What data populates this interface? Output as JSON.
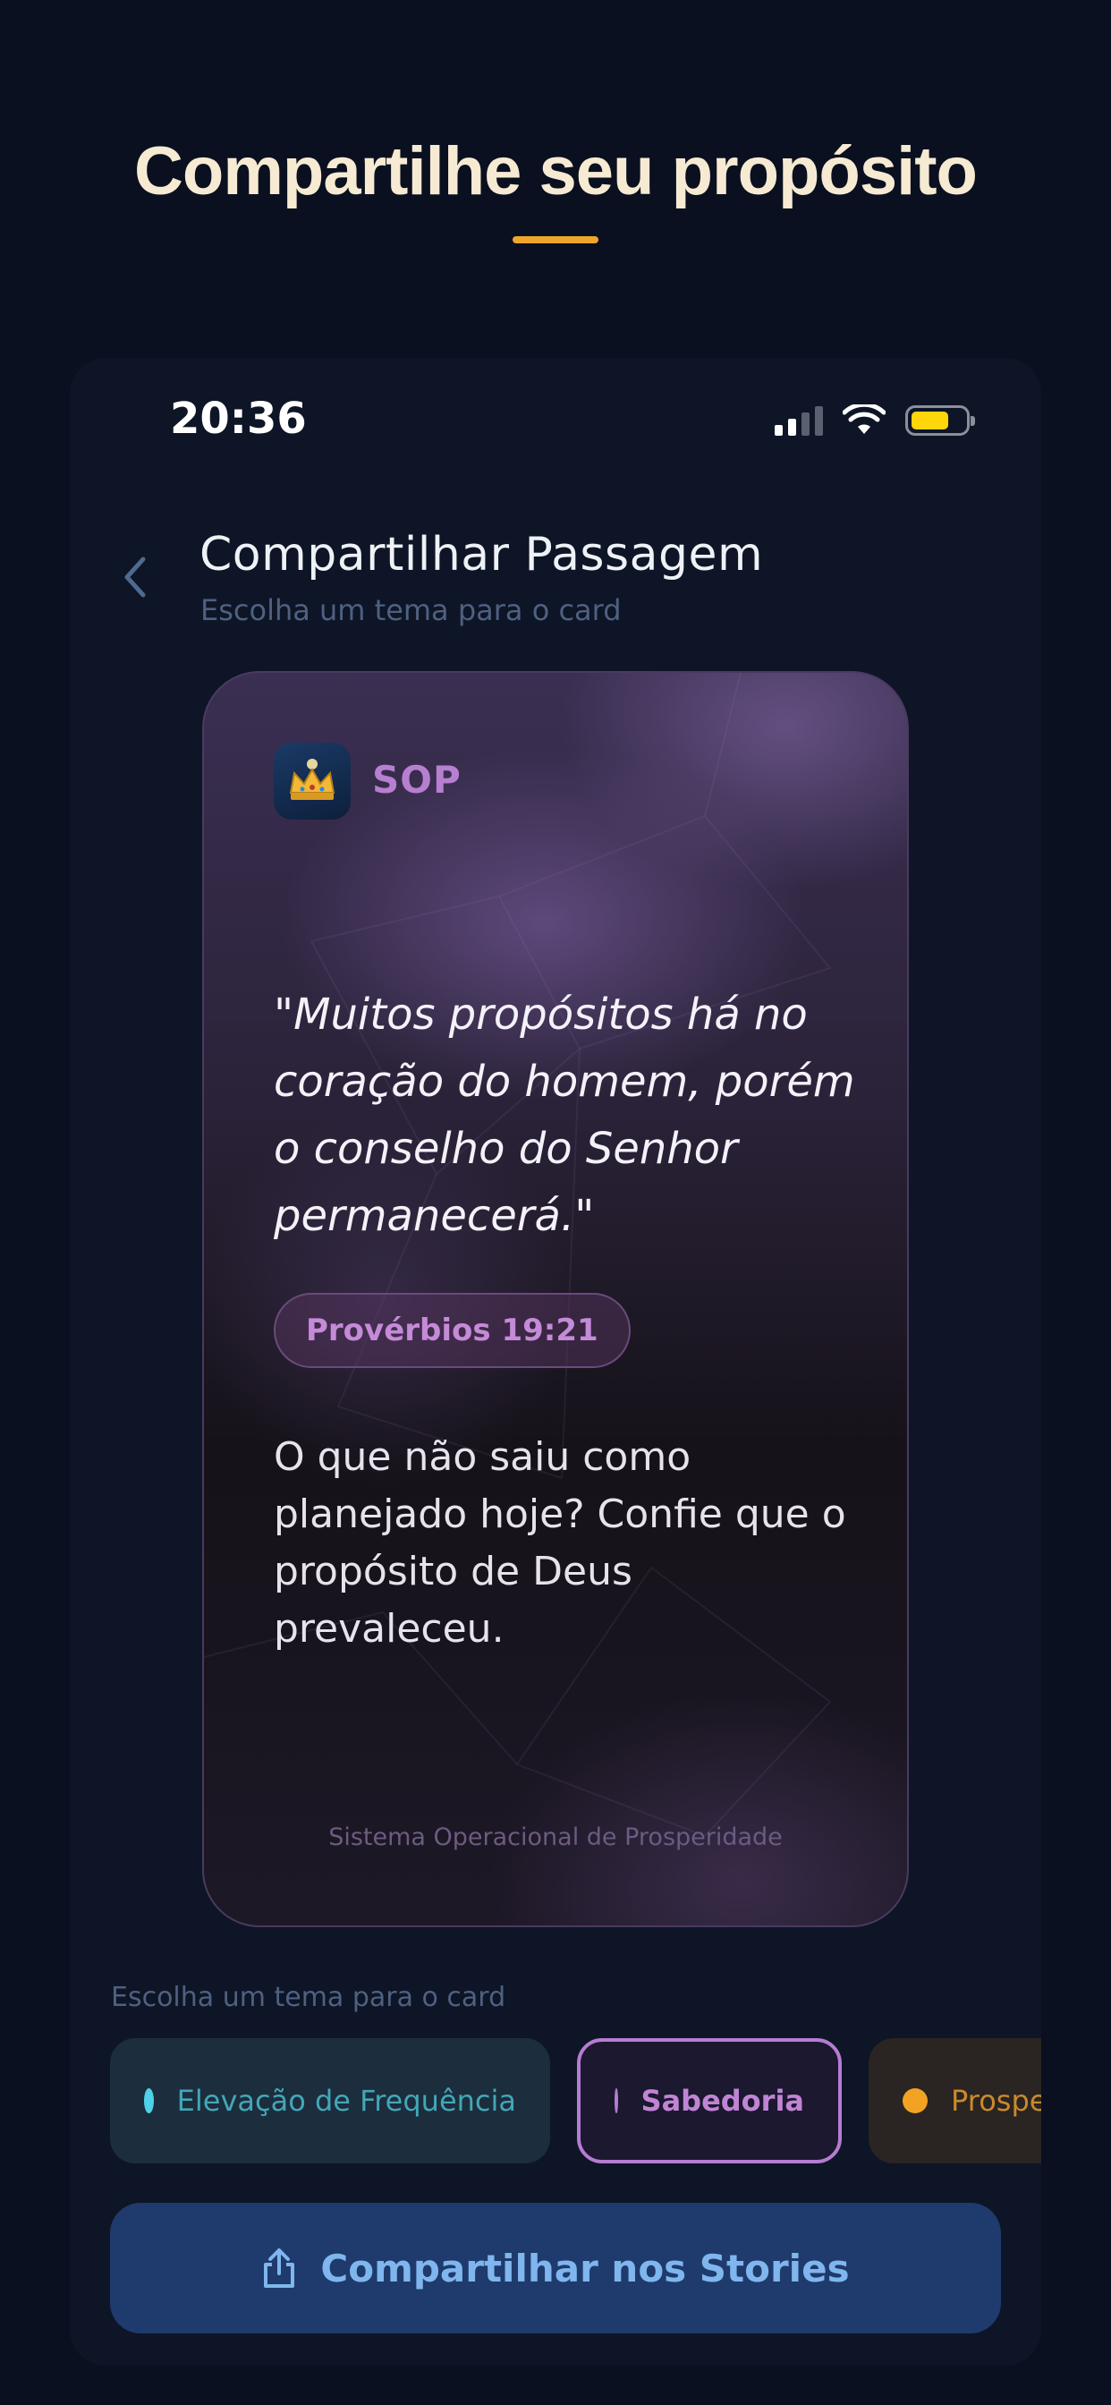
{
  "hero": {
    "title": "Compartilhe seu propósito"
  },
  "status_bar": {
    "time": "20:36"
  },
  "nav": {
    "title": "Compartilhar Passagem",
    "subtitle": "Escolha um tema para o card"
  },
  "card": {
    "brand": "SOP",
    "quote": "\"Muitos propósitos há no coração do homem, porém o conselho do Senhor permanecerá.\"",
    "reference": "Provérbios 19:21",
    "reflection": "O que não saiu como planejado hoje? Confie que o propósito de Deus prevaleceu.",
    "footer": "Sistema Operacional de Prosperidade"
  },
  "themes": {
    "label": "Escolha um tema para o card",
    "options": [
      {
        "label": "Elevação de Frequência",
        "color": "#4fd1e8",
        "selected": false
      },
      {
        "label": "Sabedoria",
        "color": "#b57cd2",
        "selected": true
      },
      {
        "label": "Prospe",
        "color": "#f3a323",
        "selected": false
      }
    ]
  },
  "share_button": {
    "label": "Compartilhar nos Stories"
  },
  "colors": {
    "accent": "#f0a62b",
    "background": "#0a1020",
    "button": "#1f3a6c"
  }
}
